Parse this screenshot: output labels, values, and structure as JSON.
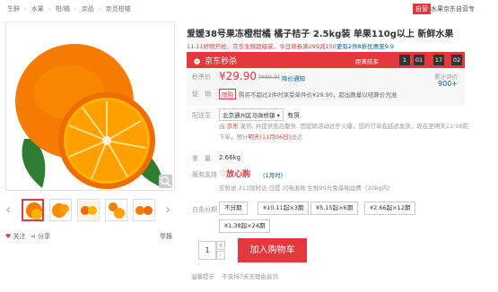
{
  "breadcrumb": [
    "生鲜",
    "水果",
    "柑/橘",
    "京品",
    "京觅柑橘"
  ],
  "shop": {
    "badge": "自营",
    "name": "水果京东自营专"
  },
  "product": {
    "title": "爱媛38号果冻橙柑橘 橘子桔子 2.5kg装 单果110g以上 新鲜水果"
  },
  "promo_bar": {
    "text": "11.11好物开抢，京东生鲜超级家，今日领券满299减150",
    "link": "更有2件8折优惠至9.9"
  },
  "seckill": {
    "title": "京东秒杀",
    "end_label": "距离结束",
    "countdown": [
      "1",
      "01",
      "17",
      "02"
    ]
  },
  "price": {
    "label": "秒杀价",
    "value": "¥29.90",
    "original": "[¥69.9]",
    "notify": "降价通知",
    "review_label": "累计评价",
    "review_count": "900+",
    "promo_label": "促　销",
    "promo_tag": "限购",
    "promo_text": "购买不超过2件时享受单件价¥29.90，超出数量以结算价为准"
  },
  "delivery": {
    "label": "配送至",
    "address": "北京通州区马驹桥镇",
    "stock": "有货",
    "line1a": "由",
    "seller": "京东",
    "line1b": "发货, 并提供售后服务. 因促销活动过于火爆，您的订单会延迟发货，现在至明天11:00前",
    "line2a": "下单，预计",
    "eta": "明天(11月06日)",
    "line2b": "送达"
  },
  "weight": {
    "label": "重　量",
    "value": "2.66kg"
  },
  "service": {
    "label": "服务支持",
    "logo": "放心购",
    "tip": "(1月时）",
    "line": "京鲜送  211限时达  日提  闪电退款  生鲜99元免基础运费（20kg内）"
  },
  "options": {
    "label": "白条分期",
    "items": [
      "不分期",
      "¥10.11起×3期",
      "¥5.15起×6期",
      "¥2.66起×12期",
      "¥1.38起×24期"
    ]
  },
  "purchase": {
    "quantity": "1",
    "plus": "+",
    "minus": "-",
    "cart": "加入购物车"
  },
  "warm_tip": {
    "label": "温馨提示",
    "text": "·不支持7天无理由退货"
  },
  "actions": {
    "follow": "关注",
    "share": "分享",
    "report": "举报"
  }
}
